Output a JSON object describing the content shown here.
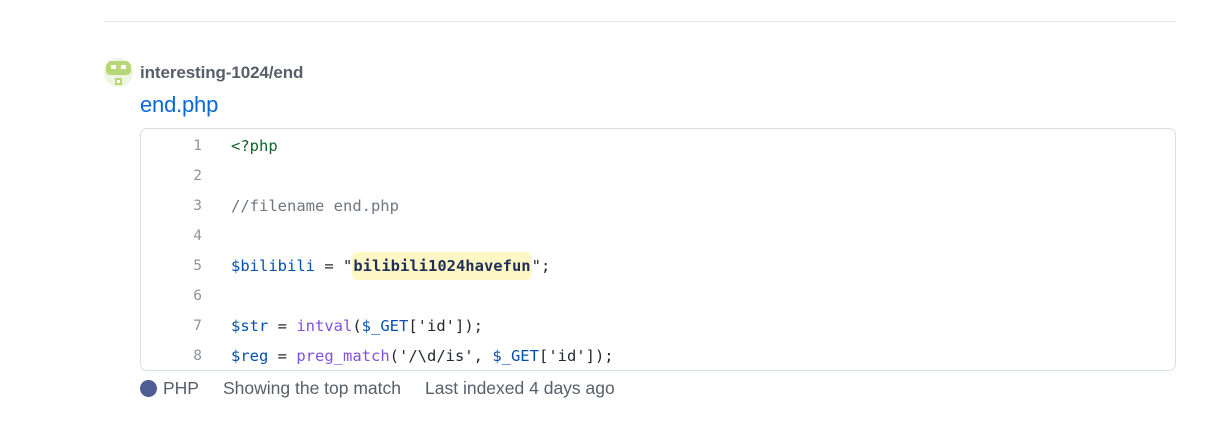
{
  "result": {
    "repo_name": "interesting-1024/end",
    "file_name": "end.php",
    "code_lines": [
      {
        "num": "1",
        "segments": [
          {
            "text": "<?php",
            "kind": "php"
          }
        ]
      },
      {
        "num": "2",
        "segments": []
      },
      {
        "num": "3",
        "segments": [
          {
            "text": "//filename end.php",
            "kind": "comment"
          }
        ]
      },
      {
        "num": "4",
        "segments": []
      },
      {
        "num": "5",
        "segments": [
          {
            "text": "$bilibili",
            "kind": "var"
          },
          {
            "text": " = \"",
            "kind": "plain"
          },
          {
            "text": "bilibili1024havefun",
            "kind": "highlight"
          },
          {
            "text": "\";",
            "kind": "plain"
          }
        ]
      },
      {
        "num": "6",
        "segments": []
      },
      {
        "num": "7",
        "segments": [
          {
            "text": "$str",
            "kind": "var"
          },
          {
            "text": " = ",
            "kind": "plain"
          },
          {
            "text": "intval",
            "kind": "func"
          },
          {
            "text": "(",
            "kind": "plain"
          },
          {
            "text": "$_GET",
            "kind": "var"
          },
          {
            "text": "['id']);",
            "kind": "plain"
          }
        ]
      },
      {
        "num": "8",
        "segments": [
          {
            "text": "$reg",
            "kind": "var"
          },
          {
            "text": " = ",
            "kind": "plain"
          },
          {
            "text": "preg_match",
            "kind": "func"
          },
          {
            "text": "('/\\d/is', ",
            "kind": "plain"
          },
          {
            "text": "$_GET",
            "kind": "var"
          },
          {
            "text": "['id']);",
            "kind": "plain"
          }
        ]
      }
    ],
    "language": "PHP",
    "language_color": "#4f5d95",
    "match_info": "Showing the top match",
    "indexed_info": "Last indexed 4 days ago",
    "avatar_icon": "robot-avatar-icon"
  }
}
